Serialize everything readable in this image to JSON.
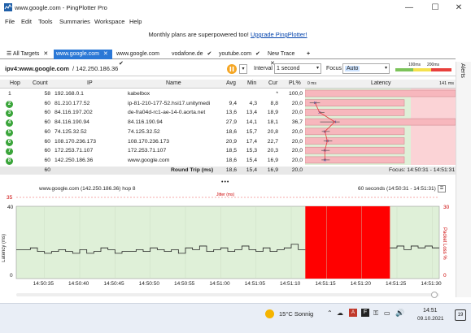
{
  "window": {
    "title": "www.google.com - PingPlotter Pro",
    "minimize": "—",
    "maximize": "☐",
    "close": "✕"
  },
  "menu": [
    "File",
    "Edit",
    "Tools",
    "Summaries",
    "Workspace",
    "Help"
  ],
  "banner": {
    "text": "Monthly plans are superpowered too! ",
    "link": "Upgrade PingPlotter!"
  },
  "tabs": [
    {
      "label": "All Targets"
    },
    {
      "label": "www.google.com",
      "active": true
    },
    {
      "label": "www.google.com"
    },
    {
      "label": "vodafone.de"
    },
    {
      "label": "youtube.com"
    },
    {
      "label": "New Trace"
    }
  ],
  "target": {
    "host": "ipv4:www.google.com",
    "ip": " / 142.250.186.36",
    "interval_label": "Interval",
    "interval_value": "1 second",
    "focus_label": "Focus",
    "focus_value": "Auto",
    "scale_100": "100ms",
    "scale_200": "200ms",
    "alerts": "Alerts"
  },
  "columns": [
    "Hop",
    "Count",
    "IP",
    "Name",
    "Avg",
    "Min",
    "Cur",
    "PL%",
    "0 ms",
    "Latency",
    "141 ms"
  ],
  "hops": [
    {
      "hop": "1",
      "count": "58",
      "ip": "192.168.0.1",
      "name": "kabelbox",
      "avg": "",
      "min": "",
      "cur": "*",
      "pl": "100,0"
    },
    {
      "hop": "2",
      "count": "60",
      "ip": "81.210.177.52",
      "name": "ip-81-210-177-52.hsi17.unitymedi",
      "avg": "9,4",
      "min": "4,3",
      "cur": "8,8",
      "pl": "20,0"
    },
    {
      "hop": "3",
      "count": "60",
      "ip": "84.116.197.202",
      "name": "de-fra04d-rc1-ae-14-0.aorta.net",
      "avg": "13,6",
      "min": "13,4",
      "cur": "18,9",
      "pl": "20,0"
    },
    {
      "hop": "4",
      "count": "60",
      "ip": "84.116.190.94",
      "name": "84.116.190.94",
      "avg": "27,9",
      "min": "14,1",
      "cur": "18,1",
      "pl": "36,7"
    },
    {
      "hop": "5",
      "count": "60",
      "ip": "74.125.32.52",
      "name": "74.125.32.52",
      "avg": "18,6",
      "min": "15,7",
      "cur": "20,8",
      "pl": "20,0"
    },
    {
      "hop": "6",
      "count": "60",
      "ip": "108.170.236.173",
      "name": "108.170.236.173",
      "avg": "20,9",
      "min": "17,4",
      "cur": "22,7",
      "pl": "20,0"
    },
    {
      "hop": "7",
      "count": "60",
      "ip": "172.253.71.107",
      "name": "172.253.71.107",
      "avg": "18,5",
      "min": "15,3",
      "cur": "20,3",
      "pl": "20,0"
    },
    {
      "hop": "8",
      "count": "60",
      "ip": "142.250.186.36",
      "name": "www.google.com",
      "avg": "18,6",
      "min": "15,4",
      "cur": "16,9",
      "pl": "20,0"
    }
  ],
  "roundtrip": {
    "count": "60",
    "label": "Round Trip (ms)",
    "avg": "18,6",
    "min": "15,4",
    "cur": "16,9",
    "pl": "20,0",
    "focus": "Focus: 14:50:31 - 14:51:31"
  },
  "graph": {
    "title": "www.google.com (142.250.186.36) hop 8",
    "range": "60 seconds (14:50:31 - 14:51:31)",
    "jitter": "Jitter (ms)",
    "y_left_label": "Latency (ms)",
    "y_right_label": "Packet Loss %",
    "top_value": "35",
    "y_ticks_left": [
      "40",
      "0"
    ],
    "y_ticks_right": [
      "30",
      "0"
    ],
    "x_ticks": [
      "14:50:35",
      "14:50:40",
      "14:50:45",
      "14:50:50",
      "14:50:55",
      "14:51:00",
      "14:51:05",
      "14:51:10",
      "14:51:15",
      "14:51:20",
      "14:51:25",
      "14:51:30"
    ],
    "latency_series": [
      16,
      16,
      17,
      15,
      14,
      15,
      16,
      15,
      14,
      16,
      14,
      15,
      17,
      16,
      14,
      15,
      15,
      16,
      15,
      17,
      16,
      15,
      16,
      14,
      17,
      16,
      18,
      15,
      16,
      17,
      15,
      16,
      18,
      16,
      15,
      17,
      15,
      16,
      17,
      19,
      16,
      16,
      18,
      16,
      17,
      16,
      15,
      18,
      16,
      16,
      15,
      17,
      16,
      17,
      18,
      16,
      18,
      17,
      18,
      17
    ],
    "loss_start_tick": "14:51:12",
    "loss_end_tick": "14:51:24"
  },
  "taskbar": {
    "weather": "15°C  Sonnig",
    "time": "14:51",
    "date": "09.10.2021",
    "notif": "19"
  },
  "colors": {
    "accent": "#2b78d6",
    "loss": "#ff0000",
    "latency_green": "#dff0d8",
    "latency_red": "#fbd3d6",
    "hop_green": "#3aa53a"
  }
}
